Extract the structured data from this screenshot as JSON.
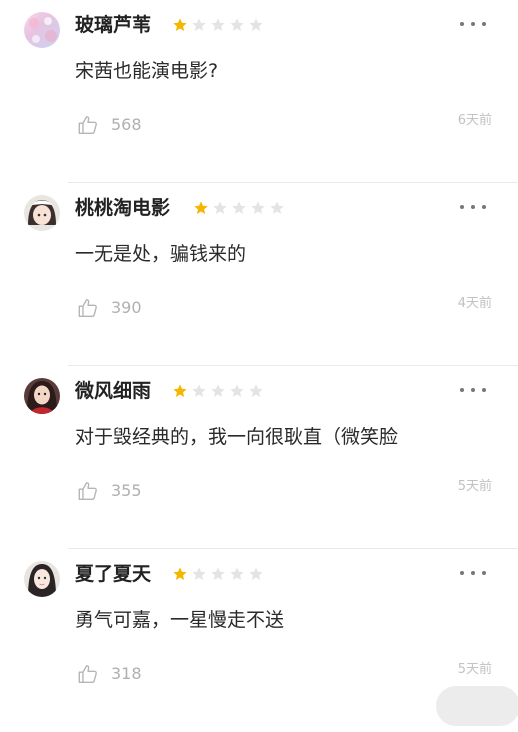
{
  "colors": {
    "star_on": "#f5b600",
    "star_off": "#e4e4e4",
    "meta_gray": "#b0b0b0"
  },
  "reviews": [
    {
      "username": "玻璃芦苇",
      "rating": 1,
      "max_rating": 5,
      "comment": "宋茜也能演电影?",
      "likes": "568",
      "time": "6天前"
    },
    {
      "username": "桃桃淘电影",
      "rating": 1,
      "max_rating": 5,
      "comment": "一无是处，骗钱来的",
      "likes": "390",
      "time": "4天前"
    },
    {
      "username": "微风细雨",
      "rating": 1,
      "max_rating": 5,
      "comment": "对于毁经典的，我一向很耿直（微笑脸",
      "likes": "355",
      "time": "5天前"
    },
    {
      "username": "夏了夏天",
      "rating": 1,
      "max_rating": 5,
      "comment": "勇气可嘉，一星慢走不送",
      "likes": "318",
      "time": "5天前"
    }
  ]
}
